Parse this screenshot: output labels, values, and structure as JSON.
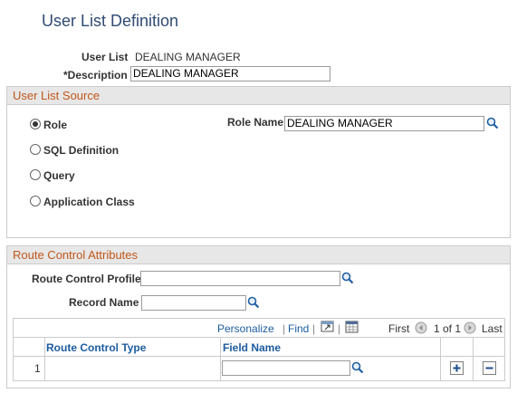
{
  "page": {
    "title": "User List Definition"
  },
  "header": {
    "user_list_label": "User List",
    "user_list_value": "DEALING MANAGER",
    "description_label": "*Description",
    "description_value": "DEALING MANAGER"
  },
  "source": {
    "section_title": "User List Source",
    "options": [
      "Role",
      "SQL Definition",
      "Query",
      "Application Class"
    ],
    "selected": "Role",
    "role_name_label": "Role Name",
    "role_name_value": "DEALING MANAGER"
  },
  "route": {
    "section_title": "Route Control Attributes",
    "profile_label": "Route Control Profile",
    "profile_value": "",
    "record_label": "Record Name",
    "record_value": ""
  },
  "grid": {
    "personalize": "Personalize",
    "find": "Find",
    "first": "First",
    "range": "1 of 1",
    "last": "Last",
    "columns": [
      "Route Control Type",
      "Field Name"
    ],
    "rows": [
      {
        "num": "1",
        "type": "",
        "field": ""
      }
    ]
  },
  "icons": {
    "lookup": "magnifier-icon",
    "view_all": "view-all-icon",
    "download": "spreadsheet-icon",
    "prev": "prev-arrow-icon",
    "next": "next-arrow-icon",
    "add": "plus-icon",
    "delete": "minus-icon"
  }
}
